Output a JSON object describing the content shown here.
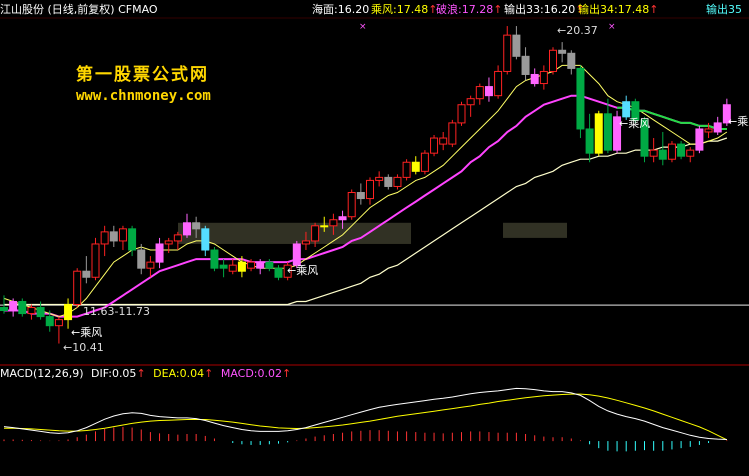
{
  "header": {
    "title": "江山股份 (日线,前复权) CFMAO",
    "items": [
      {
        "label": "海面",
        "value": "16.20",
        "arrow": "",
        "color": "#ffffff"
      },
      {
        "label": "乘风",
        "value": "17.48",
        "arrow": "↑",
        "color": "#ffff00"
      },
      {
        "label": "破浪",
        "value": "17.28",
        "arrow": "↑",
        "color": "#ff55ff"
      },
      {
        "label": "输出33",
        "value": "16.20",
        "arrow": "↑",
        "color": "#ffffff"
      },
      {
        "label": "输出34",
        "value": "17.48",
        "arrow": "↑",
        "color": "#ffff00"
      },
      {
        "label": "输出35",
        "value": "",
        "arrow": "",
        "color": "#55ffff"
      }
    ]
  },
  "watermark": {
    "line1": "第一股票公式网",
    "line2": "www.chnmoney.com"
  },
  "annotations": {
    "high_label": "20.37",
    "low_label": "10.41",
    "range_label": "11.63-11.73",
    "signal_label": "乘风"
  },
  "macd_header": {
    "name": "MACD(12,26,9)",
    "dif": "DIF:0.05",
    "dif_arrow": "↑",
    "dea": "DEA:0.04",
    "dea_arrow": "↑",
    "macd": "MACD:0.02",
    "macd_arrow": "↑"
  },
  "colors": {
    "background": "#000000",
    "up_candle": "#ff2222",
    "down_candle": "#00aa44",
    "highlight_candle": "#ff66ff",
    "neutral_candle": "#9a9a9a",
    "ma_short": "#ffff66",
    "ma_mid": "#ff44ff",
    "ma_long": "#ffffcc",
    "dif_line": "#ffffff",
    "dea_line": "#ffff00",
    "macd_up": "#ff3333",
    "macd_down": "#33ffff"
  },
  "chart_data": {
    "type": "candlestick",
    "price_axis_range": [
      9.8,
      21.1
    ],
    "reference_level": 11.68,
    "candles": [
      {
        "o": 11.6,
        "h": 12.0,
        "l": 11.4,
        "c": 11.5,
        "color": "down"
      },
      {
        "o": 11.5,
        "h": 11.9,
        "l": 11.3,
        "c": 11.8,
        "color": "highlight"
      },
      {
        "o": 11.8,
        "h": 11.9,
        "l": 11.3,
        "c": 11.4,
        "color": "down"
      },
      {
        "o": 11.4,
        "h": 11.7,
        "l": 11.2,
        "c": 11.6,
        "color": "up"
      },
      {
        "o": 11.6,
        "h": 11.8,
        "l": 11.2,
        "c": 11.3,
        "color": "down"
      },
      {
        "o": 11.3,
        "h": 11.5,
        "l": 10.8,
        "c": 11.0,
        "color": "down"
      },
      {
        "o": 11.0,
        "h": 11.3,
        "l": 10.41,
        "c": 11.2,
        "color": "up"
      },
      {
        "o": 11.2,
        "h": 11.9,
        "l": 10.9,
        "c": 11.7,
        "color": "yellow"
      },
      {
        "o": 11.7,
        "h": 12.9,
        "l": 11.6,
        "c": 12.8,
        "color": "up"
      },
      {
        "o": 12.8,
        "h": 13.3,
        "l": 12.4,
        "c": 12.6,
        "color": "neutral"
      },
      {
        "o": 12.6,
        "h": 13.9,
        "l": 12.5,
        "c": 13.7,
        "color": "up"
      },
      {
        "o": 13.7,
        "h": 14.3,
        "l": 13.3,
        "c": 14.1,
        "color": "up"
      },
      {
        "o": 14.1,
        "h": 14.3,
        "l": 13.6,
        "c": 13.8,
        "color": "neutral"
      },
      {
        "o": 13.8,
        "h": 14.3,
        "l": 13.5,
        "c": 14.2,
        "color": "up"
      },
      {
        "o": 14.2,
        "h": 14.3,
        "l": 13.3,
        "c": 13.5,
        "color": "down"
      },
      {
        "o": 13.5,
        "h": 13.7,
        "l": 12.7,
        "c": 12.9,
        "color": "neutral"
      },
      {
        "o": 12.9,
        "h": 13.3,
        "l": 12.6,
        "c": 13.1,
        "color": "up"
      },
      {
        "o": 13.1,
        "h": 13.9,
        "l": 12.9,
        "c": 13.7,
        "color": "highlight"
      },
      {
        "o": 13.7,
        "h": 13.9,
        "l": 13.4,
        "c": 13.8,
        "color": "up"
      },
      {
        "o": 13.8,
        "h": 14.1,
        "l": 13.5,
        "c": 14.0,
        "color": "up"
      },
      {
        "o": 14.0,
        "h": 14.7,
        "l": 13.9,
        "c": 14.4,
        "color": "highlight"
      },
      {
        "o": 14.4,
        "h": 14.6,
        "l": 13.9,
        "c": 14.2,
        "color": "neutral"
      },
      {
        "o": 14.2,
        "h": 14.3,
        "l": 13.3,
        "c": 13.5,
        "color": "cyan"
      },
      {
        "o": 13.5,
        "h": 13.6,
        "l": 12.8,
        "c": 12.9,
        "color": "down"
      },
      {
        "o": 12.9,
        "h": 13.2,
        "l": 12.6,
        "c": 13.0,
        "color": "down"
      },
      {
        "o": 13.0,
        "h": 13.2,
        "l": 12.7,
        "c": 12.8,
        "color": "up"
      },
      {
        "o": 12.8,
        "h": 13.3,
        "l": 12.6,
        "c": 13.1,
        "color": "yellow"
      },
      {
        "o": 13.1,
        "h": 13.2,
        "l": 12.8,
        "c": 12.9,
        "color": "up"
      },
      {
        "o": 12.9,
        "h": 13.2,
        "l": 12.7,
        "c": 13.1,
        "color": "highlight"
      },
      {
        "o": 13.1,
        "h": 13.2,
        "l": 12.8,
        "c": 12.9,
        "color": "down"
      },
      {
        "o": 12.9,
        "h": 13.0,
        "l": 12.5,
        "c": 12.6,
        "color": "down"
      },
      {
        "o": 12.6,
        "h": 13.1,
        "l": 12.5,
        "c": 13.0,
        "color": "up"
      },
      {
        "o": 13.0,
        "h": 13.8,
        "l": 12.9,
        "c": 13.7,
        "color": "highlight"
      },
      {
        "o": 13.7,
        "h": 14.1,
        "l": 13.5,
        "c": 13.8,
        "color": "up"
      },
      {
        "o": 13.8,
        "h": 14.4,
        "l": 13.6,
        "c": 14.3,
        "color": "up"
      },
      {
        "o": 14.3,
        "h": 14.6,
        "l": 14.1,
        "c": 14.3,
        "color": "yellow"
      },
      {
        "o": 14.3,
        "h": 14.7,
        "l": 14.0,
        "c": 14.5,
        "color": "up"
      },
      {
        "o": 14.5,
        "h": 14.8,
        "l": 14.2,
        "c": 14.6,
        "color": "highlight"
      },
      {
        "o": 14.6,
        "h": 15.5,
        "l": 14.5,
        "c": 15.4,
        "color": "up"
      },
      {
        "o": 15.4,
        "h": 15.7,
        "l": 15.0,
        "c": 15.2,
        "color": "neutral"
      },
      {
        "o": 15.2,
        "h": 15.9,
        "l": 15.0,
        "c": 15.8,
        "color": "up"
      },
      {
        "o": 15.8,
        "h": 16.1,
        "l": 15.6,
        "c": 15.9,
        "color": "up"
      },
      {
        "o": 15.9,
        "h": 16.0,
        "l": 15.5,
        "c": 15.6,
        "color": "neutral"
      },
      {
        "o": 15.6,
        "h": 16.0,
        "l": 15.5,
        "c": 15.9,
        "color": "up"
      },
      {
        "o": 15.9,
        "h": 16.5,
        "l": 15.8,
        "c": 16.4,
        "color": "up"
      },
      {
        "o": 16.4,
        "h": 16.6,
        "l": 16.0,
        "c": 16.1,
        "color": "yellow"
      },
      {
        "o": 16.1,
        "h": 16.8,
        "l": 16.0,
        "c": 16.7,
        "color": "up"
      },
      {
        "o": 16.7,
        "h": 17.3,
        "l": 16.6,
        "c": 17.2,
        "color": "up"
      },
      {
        "o": 17.2,
        "h": 17.4,
        "l": 16.8,
        "c": 17.0,
        "color": "up"
      },
      {
        "o": 17.0,
        "h": 17.8,
        "l": 16.9,
        "c": 17.7,
        "color": "up"
      },
      {
        "o": 17.7,
        "h": 18.4,
        "l": 17.6,
        "c": 18.3,
        "color": "up"
      },
      {
        "o": 18.3,
        "h": 18.6,
        "l": 17.9,
        "c": 18.5,
        "color": "up"
      },
      {
        "o": 18.5,
        "h": 19.0,
        "l": 18.3,
        "c": 18.9,
        "color": "up"
      },
      {
        "o": 18.9,
        "h": 19.2,
        "l": 18.4,
        "c": 18.6,
        "color": "highlight"
      },
      {
        "o": 18.6,
        "h": 19.6,
        "l": 18.5,
        "c": 19.4,
        "color": "up"
      },
      {
        "o": 19.4,
        "h": 20.9,
        "l": 19.3,
        "c": 20.6,
        "color": "up"
      },
      {
        "o": 20.6,
        "h": 20.9,
        "l": 19.8,
        "c": 19.9,
        "color": "neutral"
      },
      {
        "o": 19.9,
        "h": 20.2,
        "l": 19.1,
        "c": 19.3,
        "color": "neutral"
      },
      {
        "o": 19.3,
        "h": 19.5,
        "l": 18.9,
        "c": 19.0,
        "color": "highlight"
      },
      {
        "o": 19.0,
        "h": 19.6,
        "l": 18.8,
        "c": 19.4,
        "color": "up"
      },
      {
        "o": 19.4,
        "h": 20.2,
        "l": 19.3,
        "c": 20.1,
        "color": "up"
      },
      {
        "o": 20.1,
        "h": 20.37,
        "l": 19.7,
        "c": 20.0,
        "color": "neutral"
      },
      {
        "o": 20.0,
        "h": 20.1,
        "l": 19.3,
        "c": 19.5,
        "color": "neutral"
      },
      {
        "o": 19.5,
        "h": 19.6,
        "l": 17.2,
        "c": 17.5,
        "color": "down"
      },
      {
        "o": 17.5,
        "h": 18.0,
        "l": 16.4,
        "c": 16.7,
        "color": "down"
      },
      {
        "o": 16.7,
        "h": 18.1,
        "l": 16.6,
        "c": 18.0,
        "color": "yellow"
      },
      {
        "o": 18.0,
        "h": 18.5,
        "l": 16.7,
        "c": 16.8,
        "color": "down"
      },
      {
        "o": 16.8,
        "h": 18.1,
        "l": 16.7,
        "c": 17.9,
        "color": "highlight"
      },
      {
        "o": 17.9,
        "h": 18.6,
        "l": 17.8,
        "c": 18.4,
        "color": "cyan"
      },
      {
        "o": 18.4,
        "h": 18.5,
        "l": 17.7,
        "c": 17.8,
        "color": "down"
      },
      {
        "o": 17.8,
        "h": 17.9,
        "l": 16.4,
        "c": 16.6,
        "color": "down"
      },
      {
        "o": 16.6,
        "h": 17.2,
        "l": 16.4,
        "c": 16.8,
        "color": "up"
      },
      {
        "o": 16.8,
        "h": 17.4,
        "l": 16.3,
        "c": 16.5,
        "color": "down"
      },
      {
        "o": 16.5,
        "h": 17.1,
        "l": 16.4,
        "c": 17.0,
        "color": "up"
      },
      {
        "o": 17.0,
        "h": 17.1,
        "l": 16.5,
        "c": 16.6,
        "color": "down"
      },
      {
        "o": 16.6,
        "h": 16.9,
        "l": 16.4,
        "c": 16.8,
        "color": "up"
      },
      {
        "o": 16.8,
        "h": 17.6,
        "l": 16.7,
        "c": 17.5,
        "color": "highlight"
      },
      {
        "o": 17.5,
        "h": 17.7,
        "l": 17.2,
        "c": 17.4,
        "color": "up"
      },
      {
        "o": 17.4,
        "h": 17.9,
        "l": 17.3,
        "c": 17.7,
        "color": "highlight"
      },
      {
        "o": 17.7,
        "h": 18.5,
        "l": 17.6,
        "c": 18.3,
        "color": "highlight"
      }
    ],
    "ma_short": [
      11.9,
      11.8,
      11.7,
      11.6,
      11.5,
      11.4,
      11.3,
      11.4,
      11.6,
      11.9,
      12.3,
      12.7,
      13.1,
      13.3,
      13.5,
      13.6,
      13.5,
      13.5,
      13.5,
      13.5,
      13.7,
      13.8,
      13.8,
      13.7,
      13.5,
      13.3,
      13.1,
      13.0,
      12.9,
      12.9,
      12.9,
      12.9,
      13.0,
      13.2,
      13.4,
      13.6,
      13.8,
      14.0,
      14.3,
      14.6,
      14.9,
      15.1,
      15.3,
      15.4,
      15.6,
      15.8,
      15.9,
      16.1,
      16.3,
      16.6,
      16.9,
      17.2,
      17.5,
      17.8,
      18.1,
      18.5,
      18.9,
      19.1,
      19.2,
      19.3,
      19.4,
      19.6,
      19.6,
      19.6,
      19.3,
      19.0,
      18.6,
      18.4,
      18.3,
      18.2,
      18.0,
      17.8,
      17.6,
      17.4,
      17.2,
      17.0,
      17.0,
      17.1,
      17.2,
      17.4
    ],
    "ma_mid": [
      11.5,
      11.5,
      11.5,
      11.4,
      11.4,
      11.4,
      11.3,
      11.3,
      11.3,
      11.4,
      11.5,
      11.6,
      11.8,
      12.0,
      12.2,
      12.4,
      12.6,
      12.8,
      12.9,
      13.0,
      13.1,
      13.2,
      13.2,
      13.2,
      13.2,
      13.2,
      13.2,
      13.1,
      13.1,
      13.1,
      13.1,
      13.1,
      13.2,
      13.2,
      13.3,
      13.4,
      13.5,
      13.6,
      13.8,
      13.9,
      14.1,
      14.3,
      14.5,
      14.7,
      14.9,
      15.1,
      15.3,
      15.5,
      15.7,
      15.9,
      16.1,
      16.4,
      16.6,
      16.9,
      17.1,
      17.4,
      17.6,
      17.9,
      18.1,
      18.3,
      18.4,
      18.5,
      18.6,
      18.6,
      18.5,
      18.4,
      18.3,
      18.2,
      18.2,
      18.1,
      18.1,
      18.0,
      17.9,
      17.8,
      17.7,
      17.7,
      17.6,
      17.6,
      17.5,
      17.5
    ],
    "ma_long": [
      11.7,
      11.7,
      11.7,
      11.7,
      11.7,
      11.7,
      11.7,
      11.7,
      11.7,
      11.7,
      11.7,
      11.7,
      11.7,
      11.7,
      11.7,
      11.7,
      11.7,
      11.7,
      11.7,
      11.7,
      11.7,
      11.7,
      11.7,
      11.7,
      11.7,
      11.7,
      11.7,
      11.7,
      11.7,
      11.7,
      11.7,
      11.7,
      11.8,
      11.8,
      11.9,
      12.0,
      12.1,
      12.2,
      12.3,
      12.4,
      12.6,
      12.7,
      12.9,
      13.0,
      13.2,
      13.4,
      13.6,
      13.8,
      14.0,
      14.2,
      14.4,
      14.6,
      14.8,
      15.0,
      15.2,
      15.4,
      15.6,
      15.7,
      15.9,
      16.0,
      16.1,
      16.3,
      16.4,
      16.5,
      16.5,
      16.6,
      16.6,
      16.7,
      16.7,
      16.8,
      16.8,
      16.8,
      16.9,
      16.9,
      16.9,
      17.0,
      17.0,
      17.1,
      17.1,
      17.2
    ],
    "macd_axis_range": [
      -0.9,
      1.9
    ],
    "macd_bars": [
      0.05,
      0.05,
      0.04,
      0.03,
      0.02,
      0.01,
      0.02,
      0.05,
      0.12,
      0.2,
      0.3,
      0.38,
      0.42,
      0.44,
      0.42,
      0.36,
      0.28,
      0.24,
      0.22,
      0.2,
      0.22,
      0.22,
      0.16,
      0.08,
      0.0,
      -0.06,
      -0.1,
      -0.12,
      -0.12,
      -0.1,
      -0.08,
      -0.04,
      0.02,
      0.08,
      0.14,
      0.18,
      0.22,
      0.26,
      0.3,
      0.32,
      0.34,
      0.34,
      0.32,
      0.3,
      0.3,
      0.28,
      0.26,
      0.26,
      0.24,
      0.26,
      0.28,
      0.3,
      0.3,
      0.28,
      0.26,
      0.26,
      0.26,
      0.22,
      0.18,
      0.14,
      0.12,
      0.12,
      0.08,
      0.02,
      -0.1,
      -0.22,
      -0.3,
      -0.32,
      -0.32,
      -0.3,
      -0.28,
      -0.3,
      -0.3,
      -0.26,
      -0.22,
      -0.18,
      -0.12,
      -0.06,
      0.0,
      0.02
    ],
    "dif": [
      0.45,
      0.42,
      0.38,
      0.34,
      0.3,
      0.26,
      0.24,
      0.26,
      0.32,
      0.42,
      0.55,
      0.68,
      0.78,
      0.85,
      0.88,
      0.86,
      0.8,
      0.76,
      0.74,
      0.72,
      0.72,
      0.7,
      0.64,
      0.56,
      0.48,
      0.42,
      0.36,
      0.32,
      0.3,
      0.3,
      0.3,
      0.32,
      0.36,
      0.42,
      0.5,
      0.58,
      0.66,
      0.74,
      0.82,
      0.9,
      0.98,
      1.05,
      1.1,
      1.14,
      1.18,
      1.22,
      1.26,
      1.3,
      1.33,
      1.37,
      1.42,
      1.47,
      1.51,
      1.54,
      1.56,
      1.6,
      1.64,
      1.63,
      1.6,
      1.56,
      1.54,
      1.54,
      1.5,
      1.42,
      1.26,
      1.08,
      0.94,
      0.84,
      0.76,
      0.7,
      0.62,
      0.52,
      0.42,
      0.34,
      0.26,
      0.18,
      0.12,
      0.08,
      0.06,
      0.05
    ],
    "dea": [
      0.4,
      0.4,
      0.39,
      0.38,
      0.36,
      0.34,
      0.32,
      0.31,
      0.31,
      0.33,
      0.36,
      0.4,
      0.45,
      0.5,
      0.55,
      0.59,
      0.62,
      0.64,
      0.65,
      0.66,
      0.67,
      0.67,
      0.67,
      0.65,
      0.62,
      0.59,
      0.55,
      0.51,
      0.47,
      0.44,
      0.41,
      0.4,
      0.39,
      0.4,
      0.42,
      0.44,
      0.47,
      0.5,
      0.54,
      0.58,
      0.62,
      0.67,
      0.72,
      0.77,
      0.81,
      0.85,
      0.89,
      0.93,
      0.97,
      1.01,
      1.05,
      1.09,
      1.14,
      1.18,
      1.23,
      1.27,
      1.31,
      1.35,
      1.38,
      1.41,
      1.43,
      1.45,
      1.46,
      1.46,
      1.44,
      1.4,
      1.34,
      1.27,
      1.19,
      1.11,
      1.03,
      0.94,
      0.84,
      0.74,
      0.64,
      0.54,
      0.44,
      0.32,
      0.18,
      0.04
    ]
  }
}
